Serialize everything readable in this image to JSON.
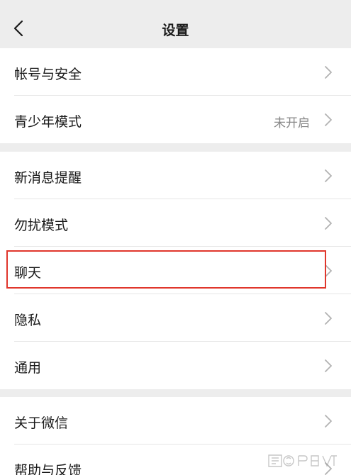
{
  "header": {
    "title": "设置"
  },
  "sections": [
    {
      "items": [
        {
          "label": "帐号与安全",
          "value": ""
        },
        {
          "label": "青少年模式",
          "value": "未开启"
        }
      ]
    },
    {
      "items": [
        {
          "label": "新消息提醒",
          "value": ""
        },
        {
          "label": "勿扰模式",
          "value": ""
        },
        {
          "label": "聊天",
          "value": "",
          "highlighted": true
        },
        {
          "label": "隐私",
          "value": ""
        },
        {
          "label": "通用",
          "value": ""
        }
      ]
    },
    {
      "items": [
        {
          "label": "关于微信",
          "value": ""
        },
        {
          "label": "帮助与反馈",
          "value": ""
        }
      ]
    }
  ],
  "colors": {
    "background": "#ededed",
    "card": "#ffffff",
    "highlight": "#e0362c",
    "value_text": "#888888"
  },
  "icons": {
    "back": "chevron-left-icon",
    "row": "chevron-right-icon",
    "watermark": "baidu-jingyan-watermark"
  }
}
